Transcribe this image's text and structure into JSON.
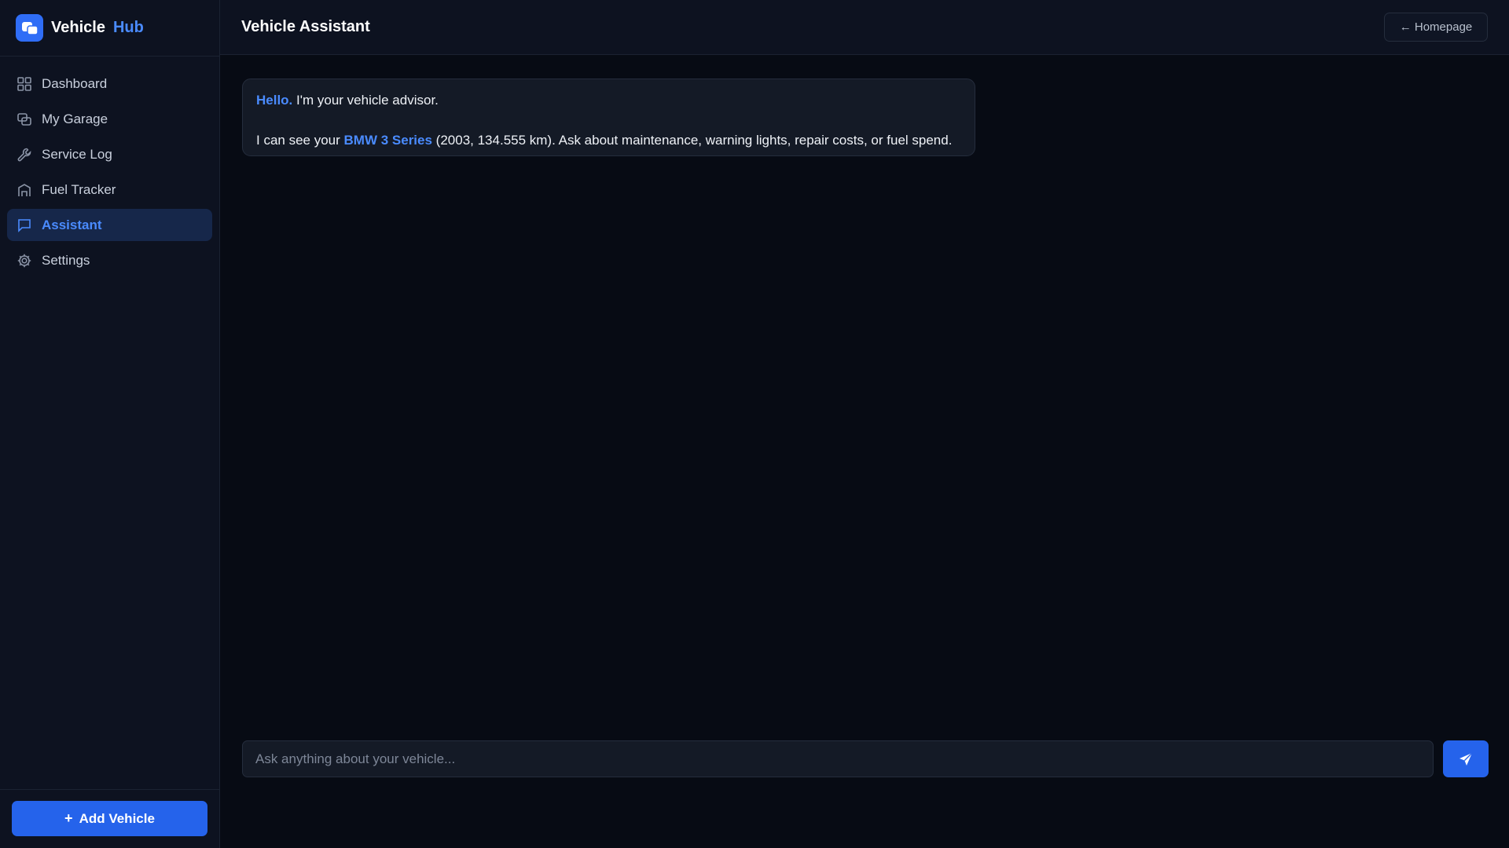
{
  "brand": {
    "name": "Vehicle",
    "accent": "Hub"
  },
  "nav": {
    "items": [
      {
        "label": "Dashboard",
        "icon": "grid-icon",
        "active": false
      },
      {
        "label": "My Garage",
        "icon": "car-stack-icon",
        "active": false
      },
      {
        "label": "Service Log",
        "icon": "wrench-icon",
        "active": false
      },
      {
        "label": "Fuel Tracker",
        "icon": "fuel-icon",
        "active": false
      },
      {
        "label": "Assistant",
        "icon": "chat-icon",
        "active": true
      },
      {
        "label": "Settings",
        "icon": "gear-icon",
        "active": false
      }
    ]
  },
  "sidebar": {
    "add_label": "Add Vehicle"
  },
  "header": {
    "title": "Vehicle Assistant",
    "home_label": "← Homepage"
  },
  "chat": {
    "messages": [
      {
        "greeting": "Hello.",
        "intro": " I'm your vehicle advisor.",
        "line2_prefix": "I can see your ",
        "vehicle": "BMW 3 Series",
        "line2_suffix": " (2003, 134.555 km). Ask about maintenance, warning lights, repair costs, or fuel spend."
      }
    ],
    "input_placeholder": "Ask anything about your vehicle...",
    "input_value": ""
  },
  "colors": {
    "accent": "#4a8bff",
    "primary_button": "#2563eb",
    "background": "#070b14",
    "surface": "#0d1220",
    "active_nav_bg": "#16274a"
  }
}
